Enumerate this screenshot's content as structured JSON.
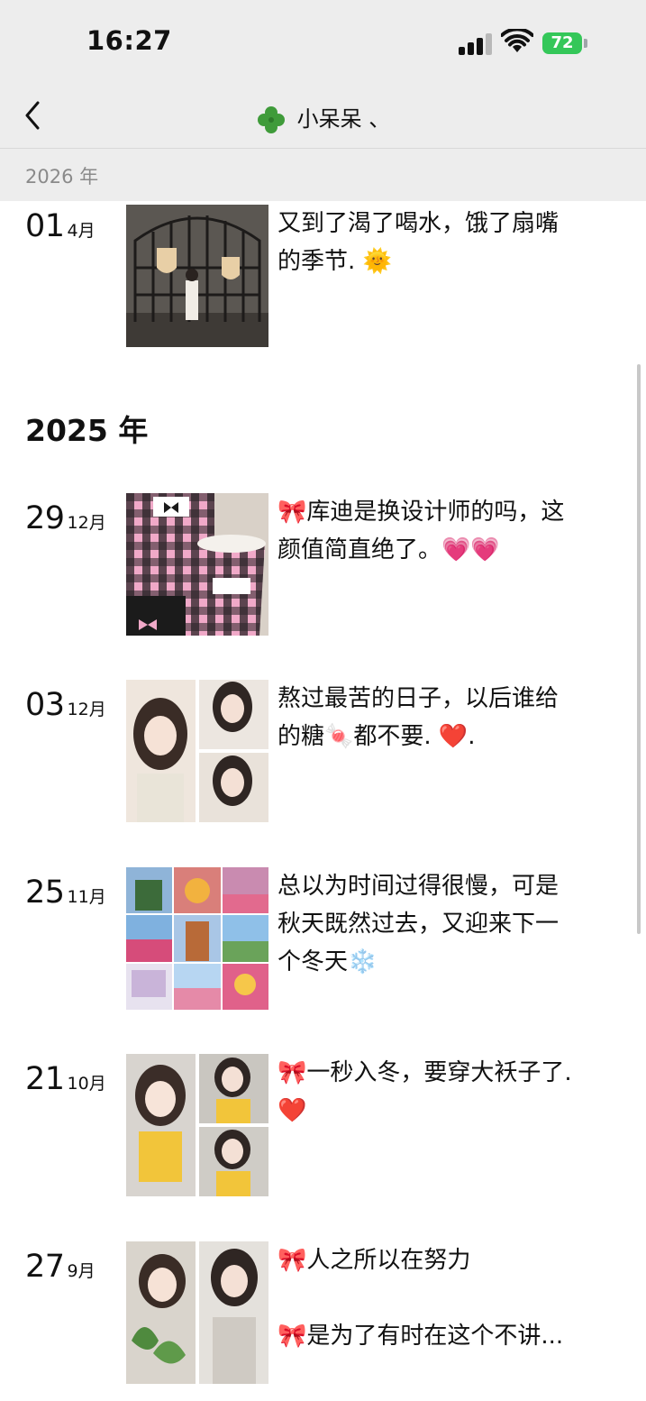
{
  "status": {
    "time": "16:27",
    "battery": "72"
  },
  "nav": {
    "title": "小呆呆 、"
  },
  "sticky_year": "2026 年",
  "year_2025": "2025 年",
  "posts": [
    {
      "day": "01",
      "month": "4月",
      "lines": [
        "又到了渴了喝水，饿了扇嘴",
        "的季节. 🌞"
      ]
    },
    {
      "day": "29",
      "month": "12月",
      "lines": [
        "🎀库迪是换设计师的吗，这",
        "颜值简直绝了。💗💗"
      ]
    },
    {
      "day": "03",
      "month": "12月",
      "lines": [
        "熬过最苦的日子，以后谁给",
        "的糖🍬都不要. ❤️."
      ]
    },
    {
      "day": "25",
      "month": "11月",
      "lines": [
        "总以为时间过得很慢，可是",
        "秋天既然过去，又迎来下一",
        "个冬天❄️"
      ]
    },
    {
      "day": "21",
      "month": "10月",
      "lines": [
        "🎀一秒入冬，要穿大袄子了.",
        "❤️"
      ]
    },
    {
      "day": "27",
      "month": "9月",
      "lines": [
        "🎀人之所以在努力",
        "",
        "🎀是为了有时在这个不讲..."
      ]
    }
  ],
  "colors": {
    "header_bg": "#ededed",
    "battery": "#34c759",
    "text": "#111111",
    "muted": "#8a8a8a"
  }
}
